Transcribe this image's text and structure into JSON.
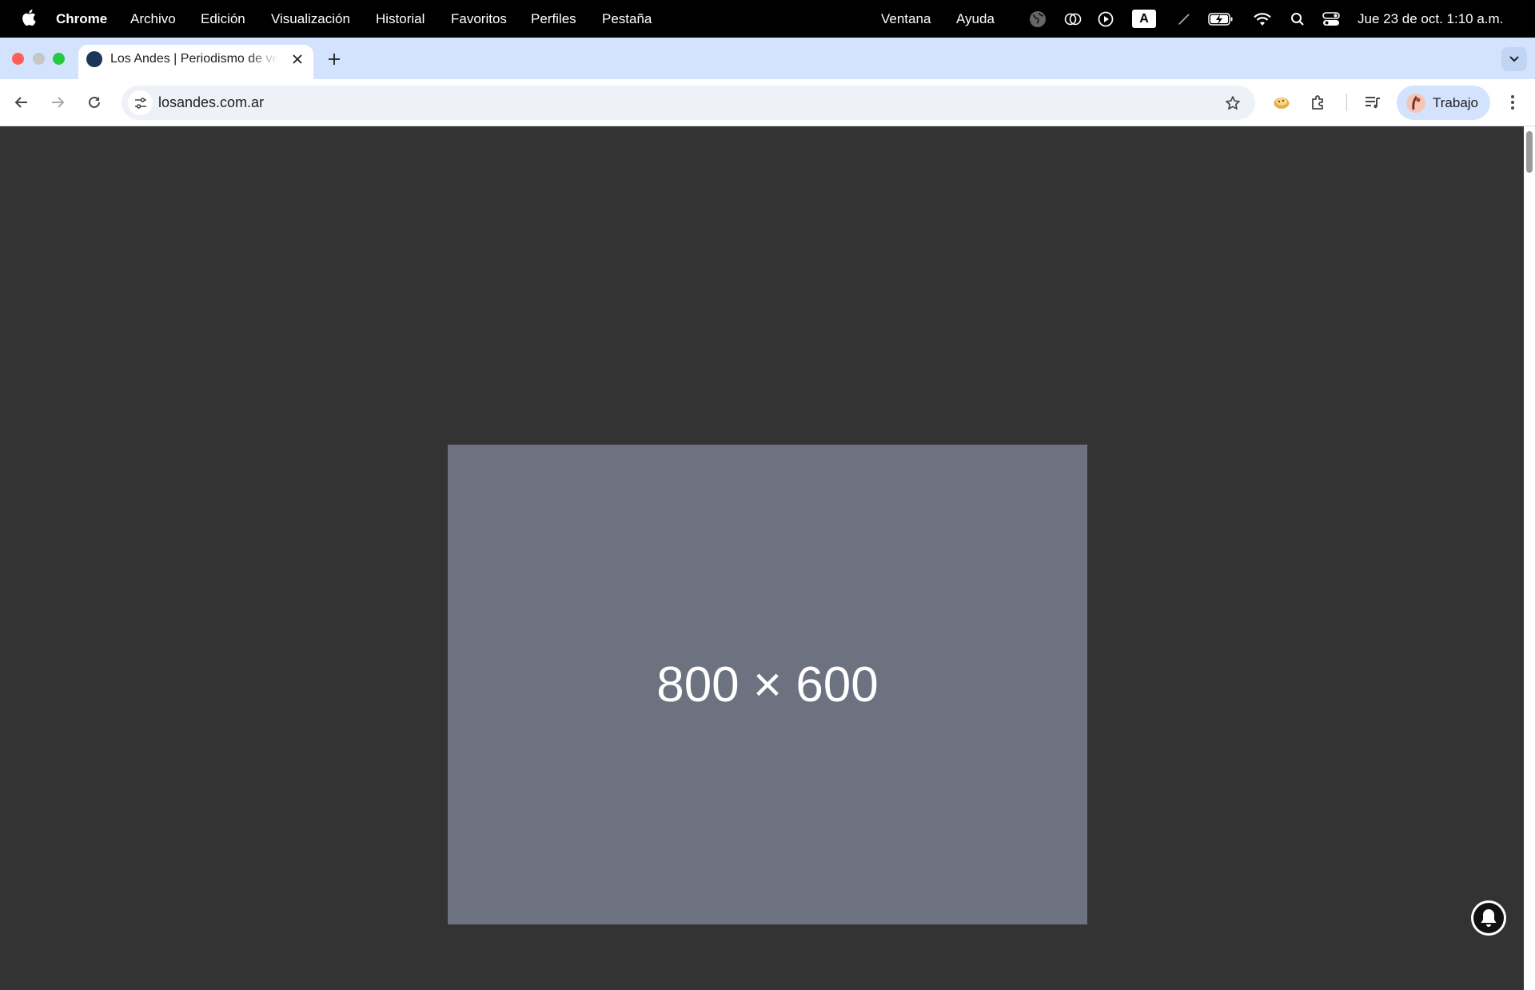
{
  "menubar": {
    "app_name": "Chrome",
    "items": [
      "Archivo",
      "Edición",
      "Visualización",
      "Historial",
      "Favoritos",
      "Perfiles",
      "Pestaña",
      "Ventana",
      "Ayuda"
    ],
    "input_source": "A",
    "clock": "Jue 23 de oct. 1:10 a.m.",
    "status_icons": [
      "globe-icon",
      "vision-icon",
      "play-icon",
      "input-source-icon",
      "pen-icon",
      "battery-icon",
      "wifi-icon",
      "spotlight-icon",
      "control-center-icon"
    ]
  },
  "tabs": [
    {
      "title": "Los Andes | Periodismo de verdad",
      "active": true
    }
  ],
  "toolbar": {
    "url": "losandes.com.ar",
    "profile_label": "Trabajo"
  },
  "page": {
    "placeholder_text": "800 × 600"
  },
  "colors": {
    "content_bg": "#333333",
    "placeholder_bg": "#6c7280",
    "tabstrip_bg": "#d3e3fd"
  }
}
